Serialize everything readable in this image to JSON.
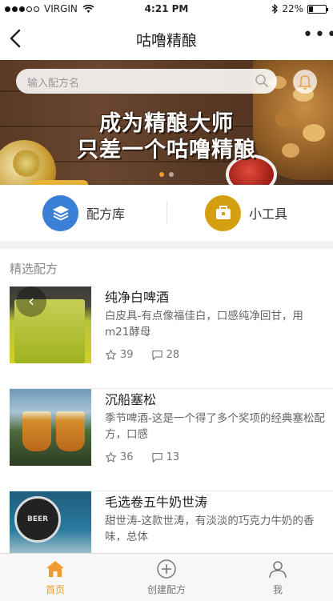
{
  "status_bar": {
    "carrier": "VIRGIN",
    "time": "4:21 PM",
    "battery": "22%"
  },
  "nav": {
    "title": "咕噜精酿",
    "back_icon": "chevron-left-icon",
    "more_icon": "more-horizontal-icon"
  },
  "banner": {
    "search_placeholder": "输入配方名",
    "slogan_line1": "成为精酿大师",
    "slogan_line2": "只差一个咕噜精酿",
    "slides": 2,
    "active_slide": 1
  },
  "quick_tools": [
    {
      "label": "配方库",
      "icon": "layers-icon",
      "color": "#3a7fd6"
    },
    {
      "label": "小工具",
      "icon": "toolbox-icon",
      "color": "#d4a012"
    }
  ],
  "featured": {
    "title": "精选配方",
    "items": [
      {
        "name": "纯净白啤酒",
        "desc": "白皮具-有点像福佳白，口感纯净回甘，用m21酵母",
        "stars": "39",
        "comments": "28"
      },
      {
        "name": "沉船塞松",
        "desc": "季节啤酒-这是一个得了多个奖项的经典塞松配方，口感",
        "stars": "36",
        "comments": "13"
      },
      {
        "name": "毛选卷五牛奶世涛",
        "desc": "甜世涛-这款世涛，有淡淡的巧克力牛奶的香味，总体",
        "stars": "",
        "comments": ""
      }
    ]
  },
  "tabbar": {
    "tabs": [
      {
        "label": "首页",
        "icon": "home-icon",
        "active": true
      },
      {
        "label": "创建配方",
        "icon": "plus-circle-icon",
        "active": false
      },
      {
        "label": "我",
        "icon": "user-icon",
        "active": false
      }
    ]
  },
  "colors": {
    "accent": "#f29a2e",
    "recipes": "#3a7fd6",
    "tools": "#d4a012"
  }
}
